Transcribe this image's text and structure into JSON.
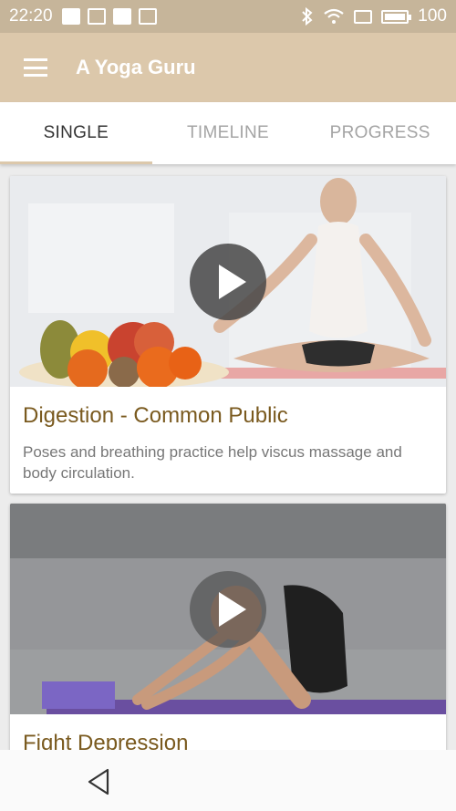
{
  "status_bar": {
    "time": "22:20",
    "battery": "100",
    "icons": [
      "upload-icon",
      "image-icon",
      "news-icon",
      "mail-icon",
      "bluetooth-icon",
      "wifi-icon",
      "sim-icon",
      "battery-icon"
    ]
  },
  "app_bar": {
    "title": "A Yoga Guru",
    "menu_icon": "hamburger-menu-icon"
  },
  "tabs": [
    {
      "label": "SINGLE",
      "active": true
    },
    {
      "label": "TIMELINE",
      "active": false
    },
    {
      "label": "PROGRESS",
      "active": false
    }
  ],
  "cards": [
    {
      "title": "Digestion - Common Public",
      "description": "Poses and breathing practice help viscus massage and body circulation."
    },
    {
      "title": "Fight Depression",
      "description": ""
    }
  ],
  "colors": {
    "status_bar": "#c6b59a",
    "app_bar": "#dcc8ab",
    "card_title": "#7a5a1f",
    "tab_active": "#333333",
    "tab_inactive": "#a4a4a4"
  },
  "nav_bar": {
    "back_icon": "back-triangle-icon"
  }
}
